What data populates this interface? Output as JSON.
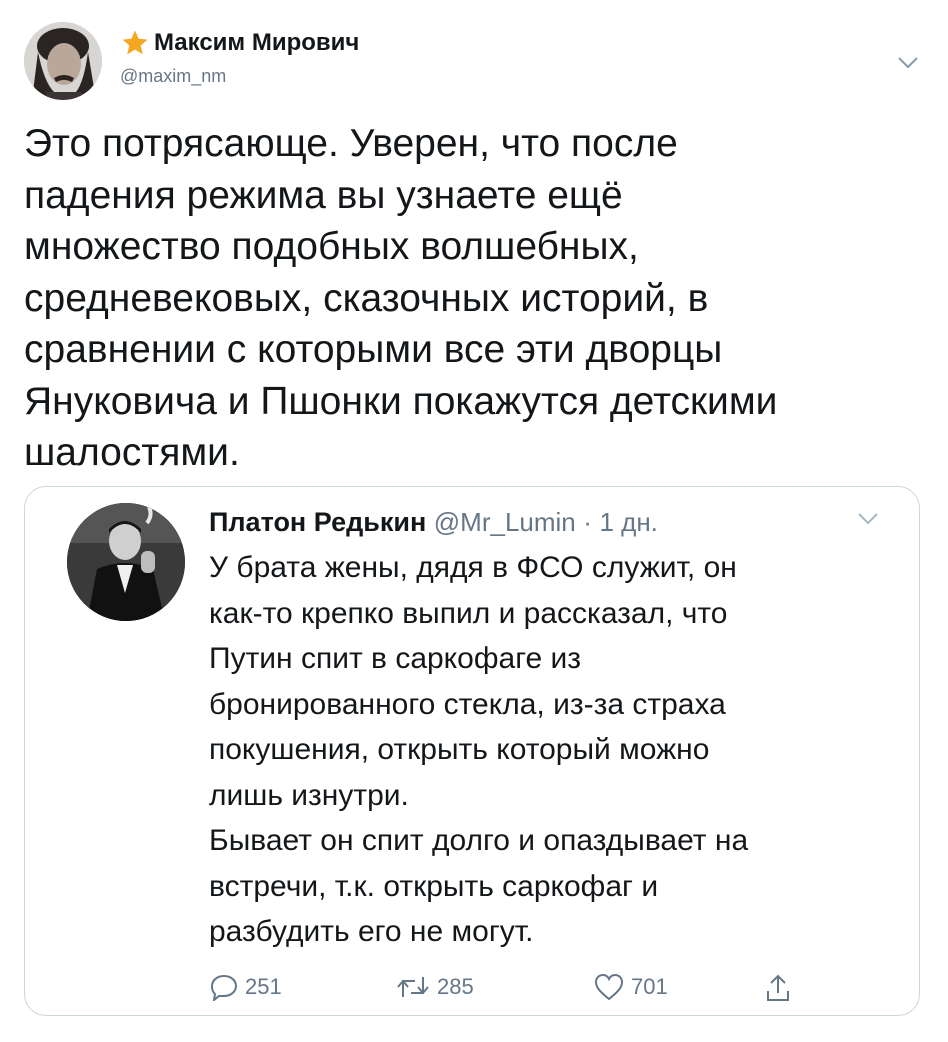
{
  "tweet": {
    "author": {
      "display_name": "Максим Мирович",
      "handle": "@maxim_nm",
      "badge_icon": "star-icon"
    },
    "text": "Это потрясающе. Уверен, что после\nпадения режима вы узнаете ещё\nмножество подобных волшебных,\nсредневековых, сказочных историй, в\nсравнении с которыми все эти дворцы\nЯнуковича и Пшонки покажутся детскими\nшалостями."
  },
  "quoted": {
    "display_name": "Платон Редькин",
    "handle": "@Mr_Lumin",
    "separator": "·",
    "time": "1 дн.",
    "text": "У брата жены, дядя в ФСО служит, он\nкак-то крепко выпил и рассказал, что\nПутин спит в саркофаге из\nбронированного стекла, из-за страха\nпокушения, открыть который можно\nлишь изнутри.\nБывает он спит долго и опаздывает на\nвстречи, т.к. открыть саркофаг и\nразбудить его не могут.",
    "actions": {
      "replies": "251",
      "retweets": "285",
      "likes": "701"
    }
  },
  "colors": {
    "text": "#14171a",
    "secondary": "#657786",
    "border": "#ccd6dd",
    "star": "#f5a623"
  }
}
